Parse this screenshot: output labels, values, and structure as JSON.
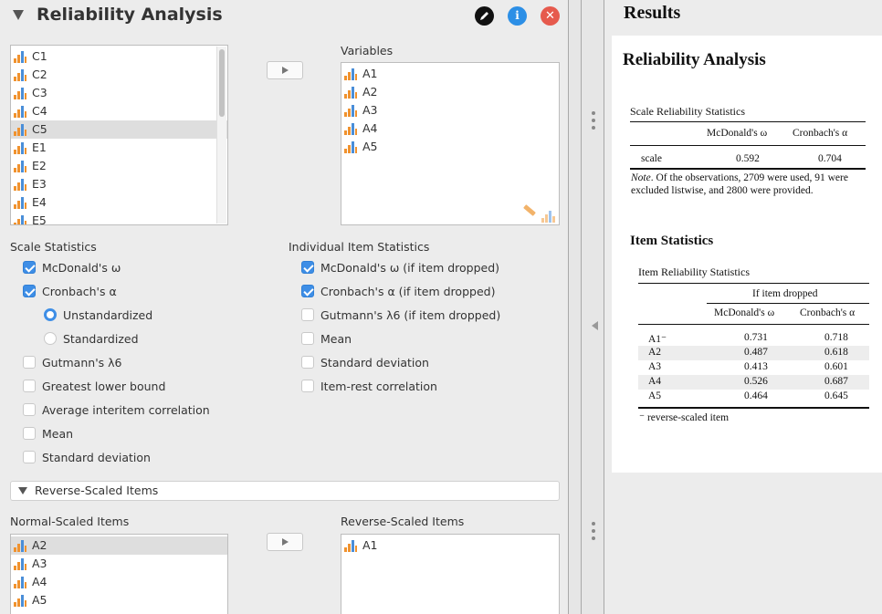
{
  "header": {
    "title": "Reliability Analysis",
    "edit_icon": "pencil-icon",
    "info_icon": "info-icon",
    "info_label": "i",
    "close_icon": "close-icon",
    "close_label": "✕"
  },
  "available_vars": [
    "C1",
    "C2",
    "C3",
    "C4",
    "C5",
    "E1",
    "E2",
    "E3",
    "E4",
    "E5"
  ],
  "available_selected": "C5",
  "variables_label": "Variables",
  "variables": [
    "A1",
    "A2",
    "A3",
    "A4",
    "A5"
  ],
  "scale_stats": {
    "label": "Scale Statistics",
    "mcdonald": "McDonald's ω",
    "cronbach": "Cronbach's α",
    "unstandardized": "Unstandardized",
    "standardized": "Standardized",
    "gutmann": "Gutmann's λ6",
    "glb": "Greatest lower bound",
    "avg_corr": "Average interitem correlation",
    "mean": "Mean",
    "sd": "Standard deviation"
  },
  "item_stats": {
    "label": "Individual Item Statistics",
    "mcdonald": "McDonald's ω  (if item dropped)",
    "cronbach": "Cronbach's α (if item dropped)",
    "gutmann": "Gutmann's λ6 (if item dropped)",
    "mean": "Mean",
    "sd": "Standard deviation",
    "item_rest": "Item-rest correlation"
  },
  "reverse_section": {
    "title": "Reverse-Scaled Items",
    "normal_label": "Normal-Scaled Items",
    "reverse_label": "Reverse-Scaled Items",
    "normal_items": [
      "A2",
      "A3",
      "A4",
      "A5"
    ],
    "normal_selected": "A2",
    "reverse_items": [
      "A1"
    ]
  },
  "results": {
    "header": "Results",
    "title": "Reliability Analysis",
    "scale_table": {
      "caption": "Scale Reliability Statistics",
      "col1": "McDonald's ω",
      "col2": "Cronbach's α",
      "row_label": "scale",
      "omega": "0.592",
      "alpha": "0.704",
      "note_prefix": "Note",
      "note_text": ". Of the observations, 2709 were used, 91 were excluded listwise, and 2800 were provided."
    },
    "item_heading": "Item Statistics",
    "item_table": {
      "caption": "Item Reliability Statistics",
      "group_header": "If item dropped",
      "col1": "McDonald's ω",
      "col2": "Cronbach's α",
      "rows": [
        {
          "item": "A1⁻",
          "omega": "0.731",
          "alpha": "0.718"
        },
        {
          "item": "A2",
          "omega": "0.487",
          "alpha": "0.618"
        },
        {
          "item": "A3",
          "omega": "0.413",
          "alpha": "0.601"
        },
        {
          "item": "A4",
          "omega": "0.526",
          "alpha": "0.687"
        },
        {
          "item": "A5",
          "omega": "0.464",
          "alpha": "0.645"
        }
      ],
      "footnote": "⁻ reverse-scaled item"
    }
  },
  "colors": {
    "accent": "#3e8ee6",
    "close": "#e65a4d",
    "bar_orange": "#f0922e",
    "bar_blue": "#4a8ed8"
  }
}
